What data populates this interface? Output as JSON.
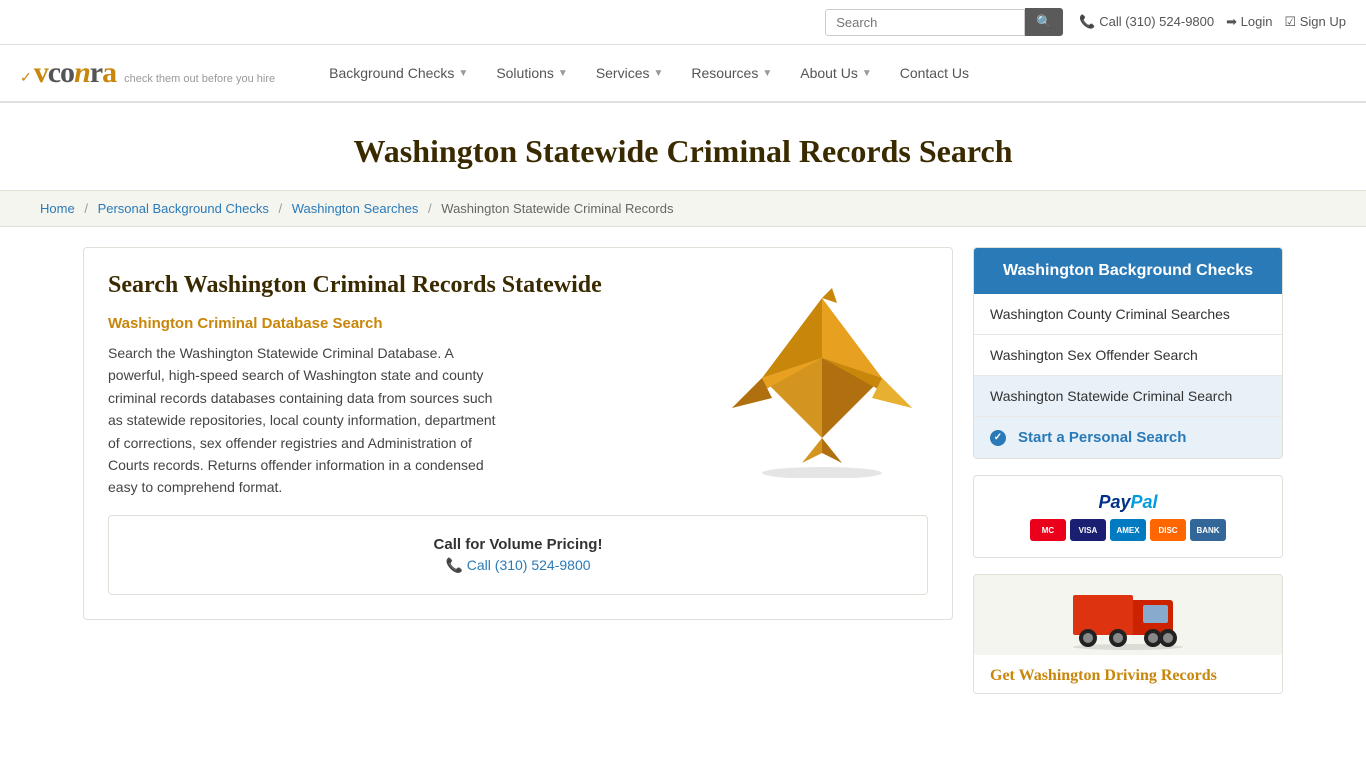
{
  "topbar": {
    "search_placeholder": "Search",
    "search_button_label": "🔍",
    "phone": "Call (310) 524-9800",
    "login": "Login",
    "signup": "Sign Up"
  },
  "nav": {
    "logo_main": "vcorra",
    "logo_tagline": "check them out before you hire",
    "items": [
      {
        "label": "Background Checks",
        "has_arrow": true
      },
      {
        "label": "Solutions",
        "has_arrow": true
      },
      {
        "label": "Services",
        "has_arrow": true
      },
      {
        "label": "Resources",
        "has_arrow": true
      },
      {
        "label": "About Us",
        "has_arrow": true
      },
      {
        "label": "Contact Us",
        "has_arrow": false
      }
    ]
  },
  "page": {
    "title": "Washington Statewide Criminal Records Search",
    "breadcrumbs": [
      {
        "label": "Home",
        "link": true
      },
      {
        "label": "Personal Background Checks",
        "link": true
      },
      {
        "label": "Washington Searches",
        "link": true
      },
      {
        "label": "Washington Statewide Criminal Records",
        "link": false
      }
    ]
  },
  "main": {
    "content_title": "Search Washington Criminal Records Statewide",
    "section_title": "Washington Criminal Database Search",
    "content_text": "Search the Washington Statewide Criminal Database. A powerful, high-speed search of Washington state and county criminal records databases containing data from sources such as statewide repositories, local county information, department of corrections, sex offender registries and Administration of Courts records. Returns offender information in a condensed easy to comprehend format.",
    "call_box": {
      "title": "Call for Volume Pricing!",
      "number": "Call (310) 524-9800"
    }
  },
  "sidebar": {
    "header": "Washington Background Checks",
    "items": [
      {
        "label": "Washington County Criminal Searches"
      },
      {
        "label": "Washington Sex Offender Search"
      },
      {
        "label": "Washington Statewide Criminal Search"
      }
    ],
    "cta": "Start a Personal Search",
    "paypal_label": "PayPal",
    "payment_methods": [
      "MC",
      "VISA",
      "AMEX",
      "DISC",
      "BANK"
    ],
    "driving_title": "Get Washington Driving Records"
  }
}
